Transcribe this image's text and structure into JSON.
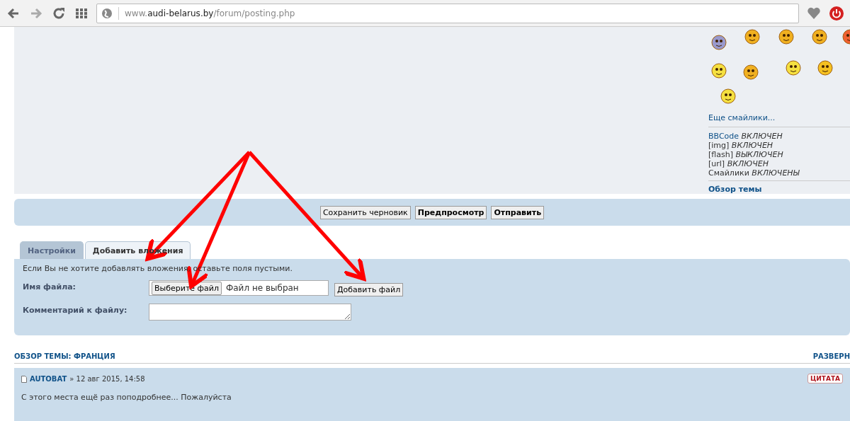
{
  "browser": {
    "url_prefix": "www.",
    "url_domain": "audi-belarus.by",
    "url_path": "/forum/posting.php"
  },
  "smilies_link": "Еще смайлики...",
  "bbcode_status": [
    {
      "label": "BBCode",
      "value": "ВКЛЮЧЕН",
      "kind": "link"
    },
    {
      "label": "[img]",
      "value": "ВКЛЮЧЕН",
      "kind": "text"
    },
    {
      "label": "[flash]",
      "value": "ВЫКЛЮЧЕН",
      "kind": "text"
    },
    {
      "label": "[url]",
      "value": "ВКЛЮЧЕН",
      "kind": "text"
    },
    {
      "label": "Смайлики",
      "value": "ВКЛЮЧЕНЫ",
      "kind": "text"
    }
  ],
  "topic_review_link": "Обзор темы",
  "buttons": [
    {
      "label": "Сохранить черновик",
      "primary": false
    },
    {
      "label": "Предпросмотр",
      "primary": true
    },
    {
      "label": "Отправить",
      "primary": true
    }
  ],
  "tabs": [
    {
      "label": "Настройки",
      "selected": false
    },
    {
      "label": "Добавить вложения",
      "selected": true
    }
  ],
  "attach": {
    "hint": "Если Вы не хотите добавлять вложения, оставьте поля пустыми.",
    "file_label": "Имя файла:",
    "choose_button": "Выберите файл",
    "no_file": "Файл не выбран",
    "add_button": "Добавить файл",
    "comment_label": "Комментарий к файлу:"
  },
  "review": {
    "title": "ОБЗОР ТЕМЫ: ФРАНЦИЯ",
    "expand": "РАЗВЕРН",
    "posts": [
      {
        "author": "AUTOBAT",
        "date": "» 12 авг 2015, 14:58",
        "quote": "ЦИТАТА",
        "text": "С этого места ещё раз поподробнее... Пожалуйста"
      }
    ]
  }
}
